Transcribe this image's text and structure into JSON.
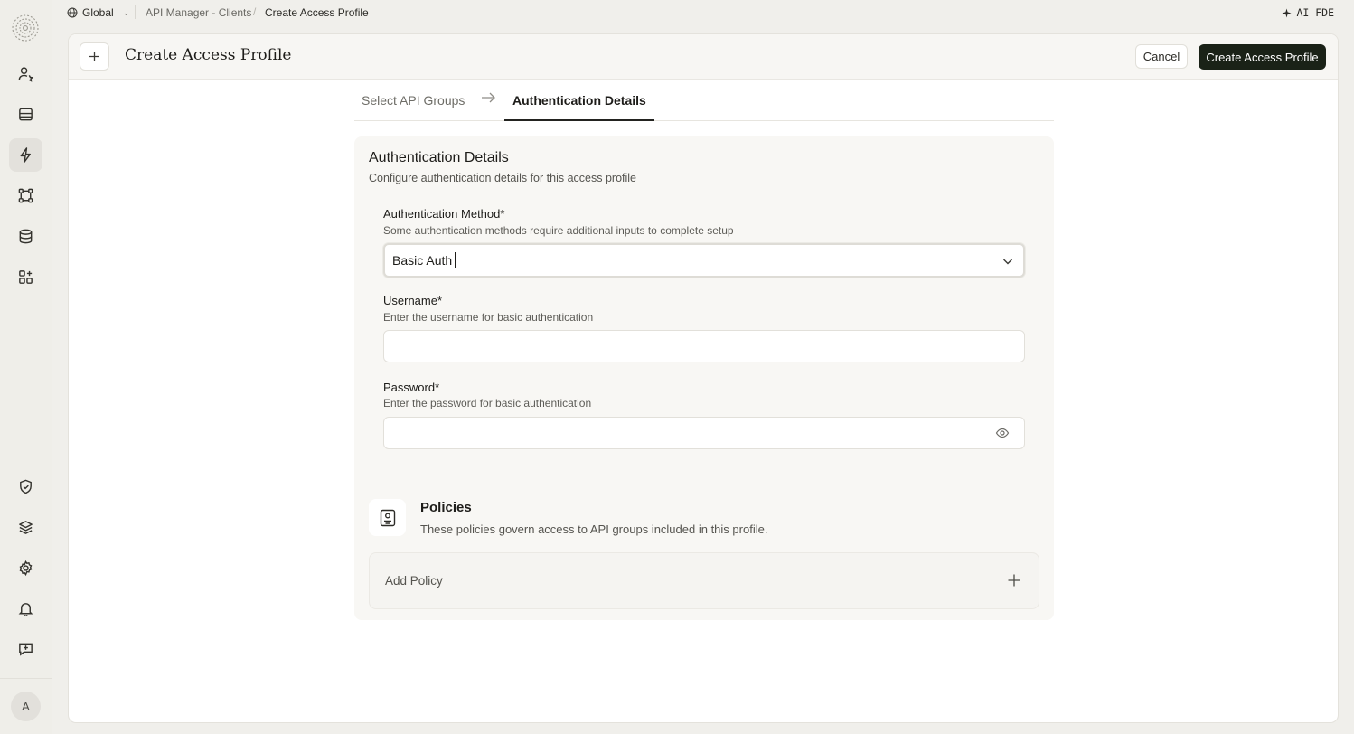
{
  "topbar": {
    "scope": "Global",
    "breadcrumb_parent": "API Manager - Clients",
    "breadcrumb_current": "Create Access Profile",
    "ai_label": "AI FDE"
  },
  "header": {
    "title": "Create Access Profile",
    "cancel_label": "Cancel",
    "create_label": "Create Access Profile"
  },
  "steps": {
    "step1": "Select API Groups",
    "step2": "Authentication Details",
    "active": "Authentication Details"
  },
  "card": {
    "title": "Authentication Details",
    "subtitle": "Configure authentication details for this access profile"
  },
  "auth_method": {
    "label": "Authentication Method*",
    "help": "Some authentication methods require additional inputs to complete setup",
    "value": "Basic Auth"
  },
  "username": {
    "label": "Username*",
    "help": "Enter the username for basic authentication",
    "value": ""
  },
  "password": {
    "label": "Password*",
    "help": "Enter the password for basic authentication",
    "value": ""
  },
  "policies": {
    "title": "Policies",
    "subtitle": "These policies govern access to API groups included in this profile.",
    "add_label": "Add Policy"
  },
  "user": {
    "avatar_initial": "A"
  },
  "icons": {
    "rail": [
      "users-icon",
      "inbox-icon",
      "lightning-icon",
      "nodes-icon",
      "database-icon",
      "apps-icon",
      "shield-icon",
      "layers-icon",
      "gear-icon",
      "bell-icon",
      "feedback-icon"
    ],
    "active_rail_item": "lightning-icon"
  },
  "colors": {
    "primary_button": "#1a2217",
    "background": "#f0efeb",
    "card": "#f8f7f4"
  }
}
